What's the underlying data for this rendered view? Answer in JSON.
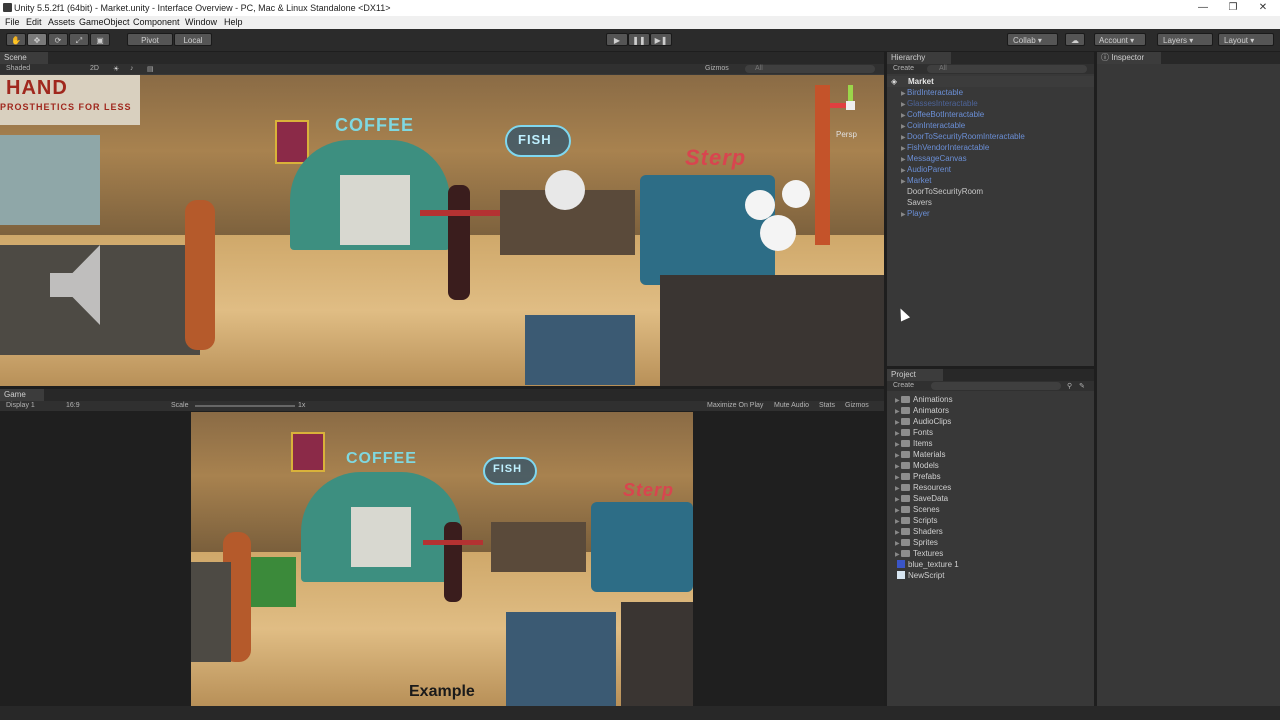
{
  "window": {
    "title": "Unity 5.5.2f1 (64bit) - Market.unity - Interface Overview - PC, Mac & Linux Standalone <DX11>",
    "minimize": "—",
    "maximize": "❐",
    "close": "✕"
  },
  "menu": [
    "File",
    "Edit",
    "Assets",
    "GameObject",
    "Component",
    "Window",
    "Help"
  ],
  "toolbar": {
    "pivot": "Pivot",
    "local": "Local",
    "collab": "Collab",
    "account": "Account",
    "layers": "Layers",
    "layout": "Layout"
  },
  "scene": {
    "tab": "Scene",
    "shading": "Shaded",
    "mode2d": "2D",
    "gizmos": "Gizmos",
    "search_all": "All",
    "persp": "Persp",
    "signs": {
      "hand": "HAND",
      "hand_sub": "PROSTHETICS FOR LESS",
      "coffee": "COFFEE",
      "fish": "FISH",
      "sterp": "Sterp"
    }
  },
  "game": {
    "tab": "Game",
    "display": "Display 1",
    "aspect": "16:9",
    "scale_label": "Scale",
    "scale_value": "1x",
    "maximize": "Maximize On Play",
    "mute": "Mute Audio",
    "stats": "Stats",
    "gizmos": "Gizmos",
    "watermark": "Example"
  },
  "hierarchy": {
    "tab": "Hierarchy",
    "create": "Create",
    "search_all": "All",
    "root": "Market",
    "items": [
      {
        "label": "BirdInteractable",
        "color": "#6b8fd6",
        "arrow": true
      },
      {
        "label": "GlassesInteractable",
        "color": "#4d6499",
        "arrow": true
      },
      {
        "label": "CoffeeBotInteractable",
        "color": "#6b8fd6",
        "arrow": true
      },
      {
        "label": "CoinInteractable",
        "color": "#6b8fd6",
        "arrow": true
      },
      {
        "label": "DoorToSecurityRoomInteractable",
        "color": "#6b8fd6",
        "arrow": true
      },
      {
        "label": "FishVendorInteractable",
        "color": "#6b8fd6",
        "arrow": true
      },
      {
        "label": "MessageCanvas",
        "color": "#6b8fd6",
        "arrow": true
      },
      {
        "label": "AudioParent",
        "color": "#6b8fd6",
        "arrow": true
      },
      {
        "label": "Market",
        "color": "#6b8fd6",
        "arrow": true
      },
      {
        "label": "DoorToSecurityRoom",
        "color": "#c8c8c8",
        "arrow": false
      },
      {
        "label": "Savers",
        "color": "#c8c8c8",
        "arrow": false
      },
      {
        "label": "Player",
        "color": "#6b8fd6",
        "arrow": true
      }
    ]
  },
  "inspector": {
    "tab": "Inspector"
  },
  "project": {
    "tab": "Project",
    "create": "Create",
    "folders": [
      "Animations",
      "Animators",
      "AudioClips",
      "Fonts",
      "Items",
      "Materials",
      "Models",
      "Prefabs",
      "Resources",
      "SaveData",
      "Scenes",
      "Scripts",
      "Shaders",
      "Sprites",
      "Textures"
    ],
    "assets": [
      {
        "label": "blue_texture 1",
        "icon": "texture-icon"
      },
      {
        "label": "NewScript",
        "icon": "script-icon"
      }
    ]
  }
}
